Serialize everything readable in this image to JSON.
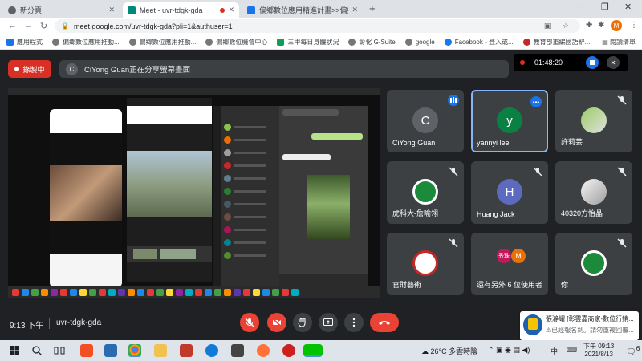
{
  "browser": {
    "tabs": [
      {
        "title": "新分頁",
        "active": false
      },
      {
        "title": "Meet - uvr-tdgk-gda",
        "active": true
      },
      {
        "title": "偏鄉數位應用精進計畫>>偏鄉D",
        "active": false
      }
    ],
    "url": "meet.google.com/uvr-tdgk-gda?pli=1&authuser=1",
    "profile_initial": "M",
    "bookmarks": [
      "應用程式",
      "偏鄉數位應用推動...",
      "偏鄉數位應用推動...",
      "偏鄉數位機會中心",
      "三甲每日身體狀況",
      "彰化 G-Suite",
      "google",
      "Facebook - 登入或...",
      "教育部重編國語辭..."
    ],
    "reading_list": "閱讀清單"
  },
  "meet": {
    "recording_label": "錄製中",
    "presenter_initial": "C",
    "presenting_text": "CiYong Guan正在分享螢幕畫面",
    "recording_time": "01:48:20",
    "participants": [
      {
        "name": "CiYong Guan",
        "initial": "C",
        "state": "speaking"
      },
      {
        "name": "yannyi lee",
        "initial": "y",
        "state": "selected"
      },
      {
        "name": "許莉芸",
        "initial": "",
        "state": "muted"
      },
      {
        "name": "虎科大-詹喻翎",
        "initial": "",
        "state": "muted"
      },
      {
        "name": "Huang Jack",
        "initial": "H",
        "state": "muted"
      },
      {
        "name": "40320方怡晶",
        "initial": "",
        "state": "muted"
      },
      {
        "name": "官財藝術",
        "initial": "",
        "state": "muted"
      },
      {
        "name": "還有另外 6 位使用者",
        "initial": "M",
        "state": "group"
      },
      {
        "name": "你",
        "initial": "",
        "state": "muted"
      }
    ],
    "others_avatar_text": "秀珠",
    "clock": "9:13 下午",
    "meeting_code": "uvr-tdgk-gda"
  },
  "notification": {
    "title": "張瀞耀 [彰雲嘉商家-數位行銷...",
    "body": "⚠已經報名到。請勿重複回覆..."
  },
  "taskbar": {
    "temperature": "26°C",
    "weather": "多雲時陰",
    "ime": "中",
    "time": "下午 09:13",
    "date": "2021/8/13",
    "notif_count": "6"
  }
}
